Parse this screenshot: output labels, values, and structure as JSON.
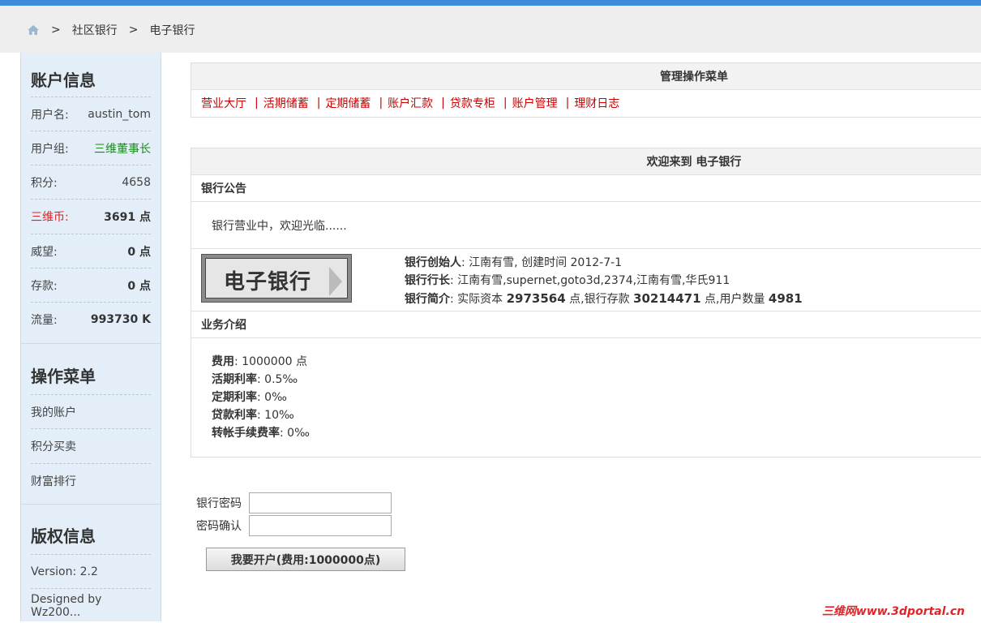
{
  "breadcrumb": {
    "items": [
      "社区银行",
      "电子银行"
    ],
    "sep": ">"
  },
  "sidebar": {
    "account_title": "账户信息",
    "account_rows": [
      {
        "key": "用户名:",
        "value": "austin_tom"
      },
      {
        "key": "用户组:",
        "value": "三维董事长"
      },
      {
        "key": "积分:",
        "value": "4658"
      },
      {
        "key": "三维币:",
        "value": "3691 点"
      },
      {
        "key": "威望:",
        "value": "0 点"
      },
      {
        "key": "存款:",
        "value": "0 点"
      },
      {
        "key": "流量:",
        "value": "993730 K"
      }
    ],
    "menu_title": "操作菜单",
    "menu_items": [
      "我的账户",
      "积分买卖",
      "财富排行"
    ],
    "copyright_title": "版权信息",
    "copyright_items": [
      "Version: 2.2",
      "Designed by Wz200..."
    ]
  },
  "menu_panel": {
    "title": "管理操作菜单",
    "links": [
      "营业大厅",
      "活期储蓄",
      "定期储蓄",
      "账户汇款",
      "贷款专柜",
      "账户管理",
      "理财日志"
    ]
  },
  "welcome_panel": {
    "title": "欢迎来到 电子银行",
    "notice_title": "银行公告",
    "notice_text": "银行营业中，欢迎光临......",
    "logo_text": "电子银行",
    "founder_label": "银行创始人",
    "founder_value": ": 江南有雪, 创建时间 2012-7-1",
    "president_label": "银行行长",
    "president_value": ": 江南有雪,supernet,goto3d,2374,江南有雪,华氏911",
    "intro_label": "银行简介",
    "intro_prefix": ": 实际资本 ",
    "capital": "2973564",
    "intro_mid1": " 点,银行存款 ",
    "deposits": "30214471",
    "intro_mid2": " 点,用户数量 ",
    "users": "4981",
    "biz_title": "业务介绍",
    "biz": [
      {
        "label": "费用",
        "value": ": 1000000 点"
      },
      {
        "label": "活期利率",
        "value": ": 0.5‰"
      },
      {
        "label": "定期利率",
        "value": ": 0‰"
      },
      {
        "label": "贷款利率",
        "value": ": 10‰"
      },
      {
        "label": "转帐手续费率",
        "value": ": 0‰"
      }
    ]
  },
  "form": {
    "password_label": "银行密码",
    "confirm_label": "密码确认",
    "submit_label": "我要开户(费用:1000000点)"
  },
  "watermark": "三维网www.3dportal.cn"
}
